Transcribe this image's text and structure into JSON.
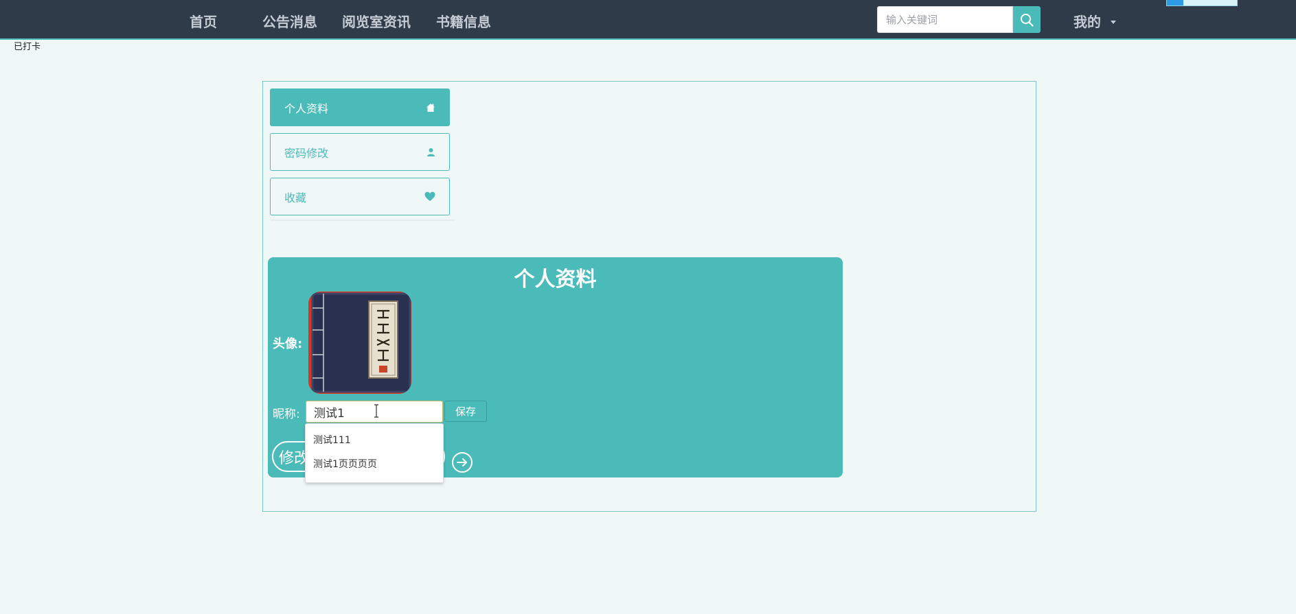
{
  "nav": {
    "items": [
      "首页",
      "公告消息",
      "阅览室资讯",
      "书籍信息"
    ],
    "search_placeholder": "输入关键词",
    "mine_label": "我的"
  },
  "top_tip": "已打卡",
  "sidebar": {
    "items": [
      {
        "label": "个人资料",
        "icon": "home-icon",
        "active": true
      },
      {
        "label": "密码修改",
        "icon": "user-icon",
        "active": false
      },
      {
        "label": "收藏",
        "icon": "heart-icon",
        "active": false
      }
    ]
  },
  "profile": {
    "title": "个人资料",
    "avatar_label": "头像:",
    "nickname_label": "昵称:",
    "nickname_value": "测试1",
    "save_label": "保存",
    "edit_label": "修改",
    "autocomplete": [
      "测试111",
      "测试1页页页页"
    ]
  },
  "colors": {
    "accent": "#4bbbb9",
    "nav_bg": "#2f3b49",
    "page_bg": "#f0f7f7"
  }
}
